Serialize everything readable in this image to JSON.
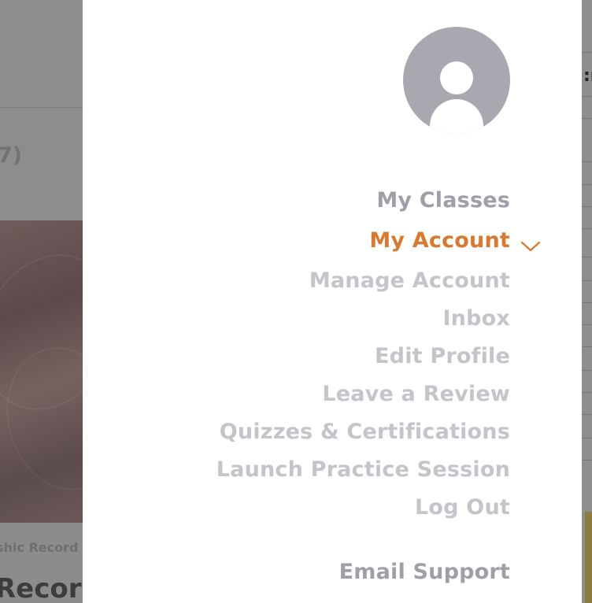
{
  "background": {
    "left_partial_paren": "7)",
    "left_caption": "shic Record",
    "left_title": "Recor",
    "right_partial_char": ":r"
  },
  "menu": {
    "my_classes": "My Classes",
    "my_account": "My Account",
    "account_items": [
      "Manage Account",
      "Inbox",
      "Edit Profile",
      "Leave a Review",
      "Quizzes & Certifications",
      "Launch Practice Session",
      "Log Out"
    ],
    "email_support": "Email Support"
  },
  "icons": {
    "avatar": "user-avatar-icon",
    "expand": "chevron-down-icon"
  },
  "colors": {
    "accent": "#d9782f",
    "primary_text": "#9f9fa8",
    "secondary_text": "#c4c4cb",
    "avatar_bg": "#a8a8b0"
  }
}
